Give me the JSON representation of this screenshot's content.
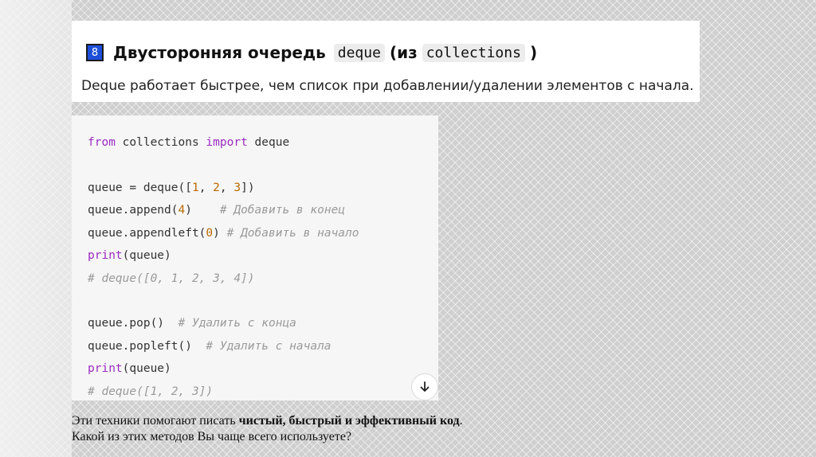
{
  "header": {
    "badge": "8",
    "title": "Двусторонняя очередь",
    "code1": "deque",
    "paren_open": "(из",
    "code2": "collections",
    "paren_close": ")",
    "subtitle": "Deque работает быстрее, чем список при добавлении/удалении элементов с начала."
  },
  "code": {
    "l1_kw1": "from",
    "l1_mid": " collections ",
    "l1_kw2": "import",
    "l1_end": " deque",
    "l2_a": "queue = deque([",
    "l2_n1": "1",
    "l2_s1": ", ",
    "l2_n2": "2",
    "l2_s2": ", ",
    "l2_n3": "3",
    "l2_end": "])",
    "l3_a": "queue.append(",
    "l3_n": "4",
    "l3_b": ")    ",
    "l3_cm": "# Добавить в конец",
    "l4_a": "queue.appendleft(",
    "l4_n": "0",
    "l4_b": ") ",
    "l4_cm": "# Добавить в начало",
    "l5_kw": "print",
    "l5_b": "(queue)",
    "l6_cm": "# deque([0, 1, 2, 3, 4])",
    "l7_a": "queue.pop()  ",
    "l7_cm": "# Удалить с конца",
    "l8_a": "queue.popleft()  ",
    "l8_cm": "# Удалить с начала",
    "l9_kw": "print",
    "l9_b": "(queue)",
    "l10_cm": "# deque([1, 2, 3])"
  },
  "footer": {
    "line1_a": "Эти техники помогают писать ",
    "line1_bold": "чистый, быстрый и эффективный код",
    "line1_end": ".",
    "line2": "Какой из этих методов Вы чаще всего используете?"
  },
  "colors": {
    "badge_blue": "#1e4fd8",
    "keyword_purple": "#9b2bc0",
    "number_orange": "#b86a00",
    "comment_gray": "#9a9a9a"
  },
  "icons": {
    "scroll": "arrow-down-icon"
  }
}
